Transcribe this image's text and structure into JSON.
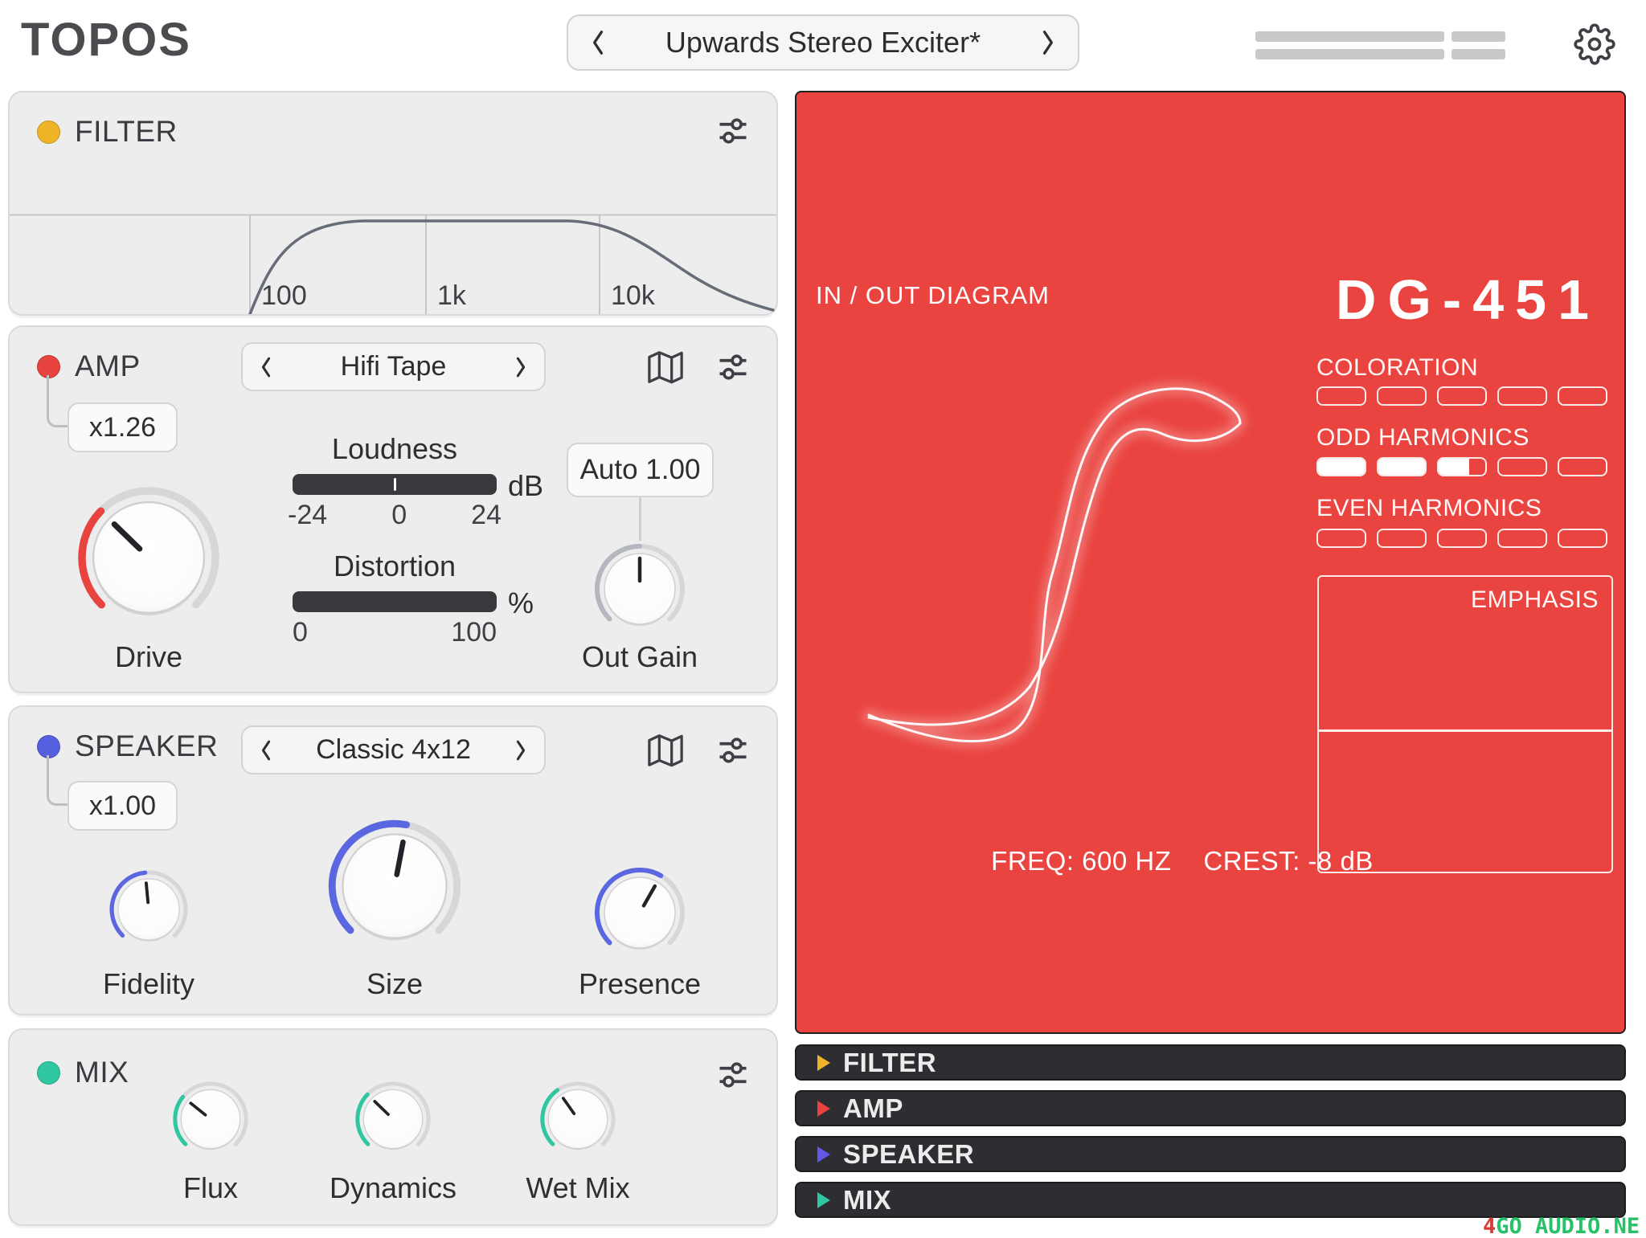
{
  "header": {
    "app_title": "TOPOS",
    "preset_name": "Upwards Stereo Exciter*"
  },
  "filter": {
    "label": "FILTER",
    "led_color": "#f0b429",
    "freq_ticks": [
      "100",
      "1k",
      "10k"
    ]
  },
  "amp": {
    "label": "AMP",
    "led_color": "#e8433e",
    "preset": "Hifi Tape",
    "multiplier": "x1.26",
    "loudness": {
      "label": "Loudness",
      "unit": "dB",
      "ticks": [
        "-24",
        "0",
        "24"
      ],
      "value": 0.5
    },
    "distortion": {
      "label": "Distortion",
      "unit": "%",
      "ticks": [
        "0",
        "100"
      ],
      "value": 0
    },
    "auto_gain_label": "Auto 1.00",
    "knobs": {
      "drive": {
        "label": "Drive",
        "value": 0.33,
        "color": "#e8433e"
      },
      "out_gain": {
        "label": "Out Gain",
        "value": 0.5,
        "color": "#b4b8be"
      }
    }
  },
  "speaker": {
    "label": "SPEAKER",
    "led_color": "#5560e0",
    "preset": "Classic 4x12",
    "multiplier": "x1.00",
    "knobs": {
      "fidelity": {
        "label": "Fidelity",
        "value": 0.48,
        "color": "#5b67e0"
      },
      "size": {
        "label": "Size",
        "value": 0.54,
        "color": "#5b67e0"
      },
      "presence": {
        "label": "Presence",
        "value": 0.61,
        "color": "#5b67e0"
      }
    }
  },
  "mix": {
    "label": "MIX",
    "led_color": "#2fc7a0",
    "knobs": {
      "flux": {
        "label": "Flux",
        "value": 0.31,
        "color": "#2fc7a0"
      },
      "dynamics": {
        "label": "Dynamics",
        "value": 0.33,
        "color": "#2fc7a0"
      },
      "wet_mix": {
        "label": "Wet Mix",
        "value": 0.37,
        "color": "#2fc7a0"
      }
    }
  },
  "display": {
    "bg_color": "#ea4440",
    "diagram_label": "IN / OUT DIAGRAM",
    "model": "DG-451",
    "meters": [
      {
        "label": "COLORATION",
        "fills": [
          0,
          0,
          0,
          0,
          0
        ]
      },
      {
        "label": "ODD HARMONICS",
        "fills": [
          1,
          1,
          0.65,
          0,
          0
        ]
      },
      {
        "label": "EVEN HARMONICS",
        "fills": [
          0,
          0,
          0,
          0,
          0
        ]
      }
    ],
    "emphasis_label": "EMPHASIS",
    "freq_readout": "FREQ: 600 HZ",
    "crest_readout": "CREST: -8 dB"
  },
  "collapsed_sections": [
    {
      "label": "FILTER",
      "color": "#f0b429"
    },
    {
      "label": "AMP",
      "color": "#e8433e"
    },
    {
      "label": "SPEAKER",
      "color": "#6456e8"
    },
    {
      "label": "MIX",
      "color": "#2fc7a0"
    }
  ],
  "watermark": {
    "prefix": "4",
    "text": "GO AUDIO.NE"
  }
}
